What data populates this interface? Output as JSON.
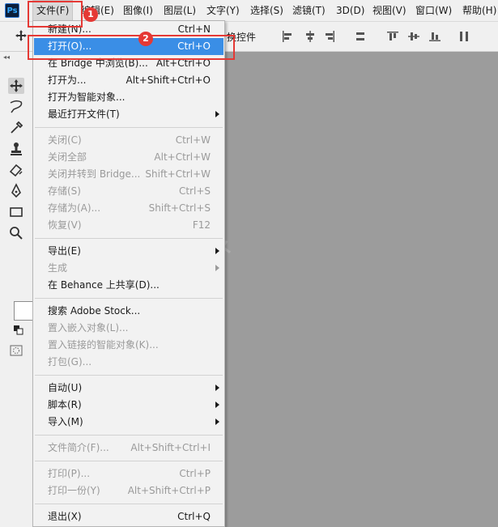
{
  "app": {
    "logo": "Ps"
  },
  "menubar": {
    "items": [
      {
        "label": "文件(F)"
      },
      {
        "label": "编辑(E)"
      },
      {
        "label": "图像(I)"
      },
      {
        "label": "图层(L)"
      },
      {
        "label": "文字(Y)"
      },
      {
        "label": "选择(S)"
      },
      {
        "label": "滤镜(T)"
      },
      {
        "label": "3D(D)"
      },
      {
        "label": "视图(V)"
      },
      {
        "label": "窗口(W)"
      },
      {
        "label": "帮助(H)"
      }
    ]
  },
  "options_bar": {
    "label": "换控件"
  },
  "file_menu": {
    "items": [
      {
        "label": "新建(N)...",
        "shortcut": "Ctrl+N"
      },
      {
        "label": "打开(O)...",
        "shortcut": "Ctrl+O"
      },
      {
        "label": "在 Bridge 中浏览(B)...",
        "shortcut": "Alt+Ctrl+O"
      },
      {
        "label": "打开为...",
        "shortcut": "Alt+Shift+Ctrl+O"
      },
      {
        "label": "打开为智能对象...",
        "shortcut": ""
      },
      {
        "label": "最近打开文件(T)",
        "shortcut": ""
      },
      {
        "label": "关闭(C)",
        "shortcut": "Ctrl+W"
      },
      {
        "label": "关闭全部",
        "shortcut": "Alt+Ctrl+W"
      },
      {
        "label": "关闭并转到 Bridge...",
        "shortcut": "Shift+Ctrl+W"
      },
      {
        "label": "存储(S)",
        "shortcut": "Ctrl+S"
      },
      {
        "label": "存储为(A)...",
        "shortcut": "Shift+Ctrl+S"
      },
      {
        "label": "恢复(V)",
        "shortcut": "F12"
      },
      {
        "label": "导出(E)",
        "shortcut": ""
      },
      {
        "label": "生成",
        "shortcut": ""
      },
      {
        "label": "在 Behance 上共享(D)...",
        "shortcut": ""
      },
      {
        "label": "搜索 Adobe Stock...",
        "shortcut": ""
      },
      {
        "label": "置入嵌入对象(L)...",
        "shortcut": ""
      },
      {
        "label": "置入链接的智能对象(K)...",
        "shortcut": ""
      },
      {
        "label": "打包(G)...",
        "shortcut": ""
      },
      {
        "label": "自动(U)",
        "shortcut": ""
      },
      {
        "label": "脚本(R)",
        "shortcut": ""
      },
      {
        "label": "导入(M)",
        "shortcut": ""
      },
      {
        "label": "文件简介(F)...",
        "shortcut": "Alt+Shift+Ctrl+I"
      },
      {
        "label": "打印(P)...",
        "shortcut": "Ctrl+P"
      },
      {
        "label": "打印一份(Y)",
        "shortcut": "Alt+Shift+Ctrl+P"
      },
      {
        "label": "退出(X)",
        "shortcut": "Ctrl+Q"
      }
    ]
  },
  "annotations": {
    "badge1": "1",
    "badge2": "2"
  },
  "watermark": "软件",
  "colors": {
    "highlight": "#3a8ee6",
    "callout": "#e53935",
    "canvas": "#9c9c9c"
  }
}
